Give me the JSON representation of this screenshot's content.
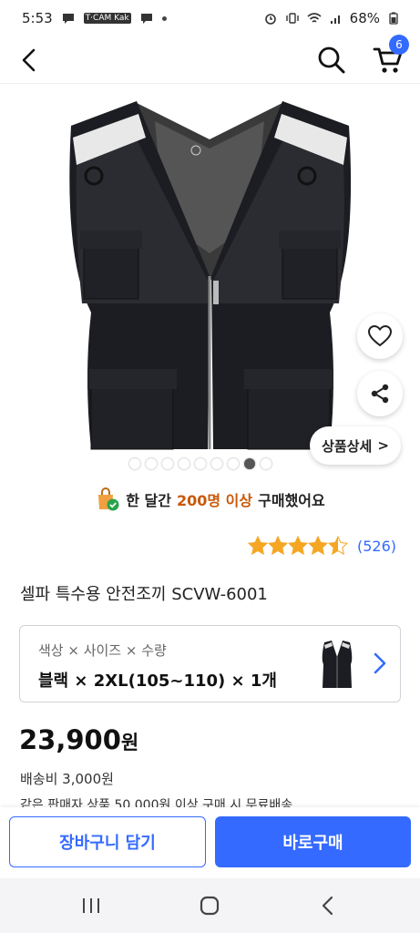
{
  "status_bar": {
    "time": "5:53",
    "battery": "68%",
    "icons": [
      "chat-bubble-icon",
      "news-app-icon",
      "chat-bubble-icon",
      "notification-dot-icon",
      "alarm-icon",
      "vibrate-icon",
      "wifi-icon",
      "signal-icon",
      "battery-icon"
    ],
    "news_icon_text": "T·CAM Kak"
  },
  "header": {
    "back_icon": "chevron-left-icon",
    "search_icon": "search-icon",
    "cart_icon": "cart-icon",
    "cart_count": "6"
  },
  "gallery": {
    "image_desc": "black mesh safety vest with reflective shoulder strips",
    "total_images": 9,
    "active_index": 8,
    "heart_icon": "heart-icon",
    "share_icon": "share-icon",
    "detail_button_label": "상품상세",
    "detail_chevron": ">"
  },
  "notice": {
    "prefix": "한 달간",
    "highlight": "200명 이상",
    "suffix": "구매했어요"
  },
  "rating": {
    "stars": 4.5,
    "count": "(526)"
  },
  "product": {
    "title": "셀파 특수용 안전조끼 SCVW-6001"
  },
  "option": {
    "label": "색상 × 사이즈 × 수량",
    "value": "블랙 × 2XL(105~110) × 1개"
  },
  "price": {
    "amount": "23,900",
    "unit": "원",
    "shipping": "배송비 3,000원",
    "shipping_note": "같은 판매자 상품 50,000원 이상 구매 시 무료배송"
  },
  "actions": {
    "add_to_cart": "장바구니 담기",
    "buy_now": "바로구매"
  },
  "colors": {
    "accent": "#346aff",
    "highlight": "#c8590b",
    "star": "#f5a623"
  }
}
